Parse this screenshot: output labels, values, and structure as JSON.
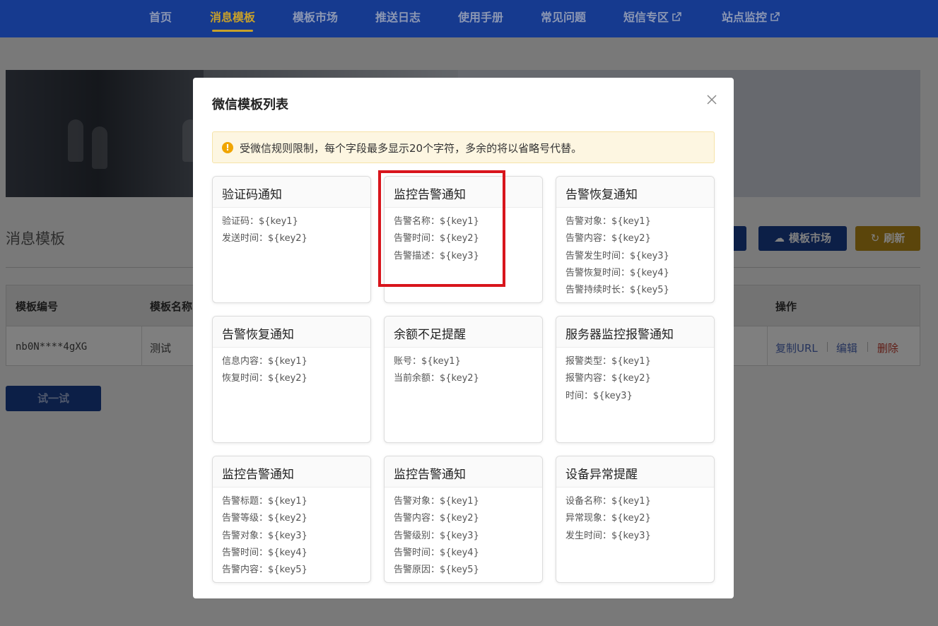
{
  "nav": {
    "items": [
      {
        "label": "首页"
      },
      {
        "label": "消息模板",
        "active": true
      },
      {
        "label": "模板市场"
      },
      {
        "label": "推送日志"
      },
      {
        "label": "使用手册"
      },
      {
        "label": "常见问题"
      },
      {
        "label": "短信专区",
        "external": true
      },
      {
        "label": "站点监控",
        "external": true
      }
    ]
  },
  "page": {
    "title": "消息模板",
    "buttons": {
      "market": "模板市场",
      "refresh": "刷新"
    },
    "table": {
      "headers": [
        "模板编号",
        "模板名称",
        "操作"
      ],
      "rows": [
        {
          "id": "nb0N****4gXG",
          "name": "测试",
          "actions": [
            "复制URL",
            "编辑",
            "删除"
          ]
        }
      ]
    },
    "try_button": "试一试"
  },
  "modal": {
    "title": "微信模板列表",
    "notice": "受微信规则限制，每个字段最多显示20个字符，多余的将以省略号代替。",
    "cards": [
      {
        "title": "验证码通知",
        "fields": [
          "验证码：${key1}",
          "发送时间：${key2}"
        ]
      },
      {
        "title": "监控告警通知",
        "fields": [
          "告警名称：${key1}",
          "告警时间：${key2}",
          "告警描述：${key3}"
        ]
      },
      {
        "title": "告警恢复通知",
        "fields": [
          "告警对象：${key1}",
          "告警内容：${key2}",
          "告警发生时间：${key3}",
          "告警恢复时间：${key4}",
          "告警持续时长：${key5}"
        ]
      },
      {
        "title": "告警恢复通知",
        "fields": [
          "信息内容：${key1}",
          "恢复时间：${key2}"
        ]
      },
      {
        "title": "余额不足提醒",
        "fields": [
          "账号：${key1}",
          "当前余额：${key2}"
        ]
      },
      {
        "title": "服务器监控报警通知",
        "fields": [
          "报警类型：${key1}",
          "报警内容：${key2}",
          "时间：${key3}"
        ]
      },
      {
        "title": "监控告警通知",
        "fields": [
          "告警标题：${key1}",
          "告警等级：${key2}",
          "告警对象：${key3}",
          "告警时间：${key4}",
          "告警内容：${key5}"
        ]
      },
      {
        "title": "监控告警通知",
        "fields": [
          "告警对象：${key1}",
          "告警内容：${key2}",
          "告警级别：${key3}",
          "告警时间：${key4}",
          "告警原因：${key5}"
        ]
      },
      {
        "title": "设备异常提醒",
        "fields": [
          "设备名称：${key1}",
          "异常现象：${key2}",
          "发生时间：${key3}"
        ]
      }
    ]
  },
  "colors": {
    "nav_bg": "#163a8f",
    "nav_active": "#c7a02a",
    "primary": "#183e8f",
    "warning": "#b78a17",
    "highlight": "#d8151c"
  }
}
